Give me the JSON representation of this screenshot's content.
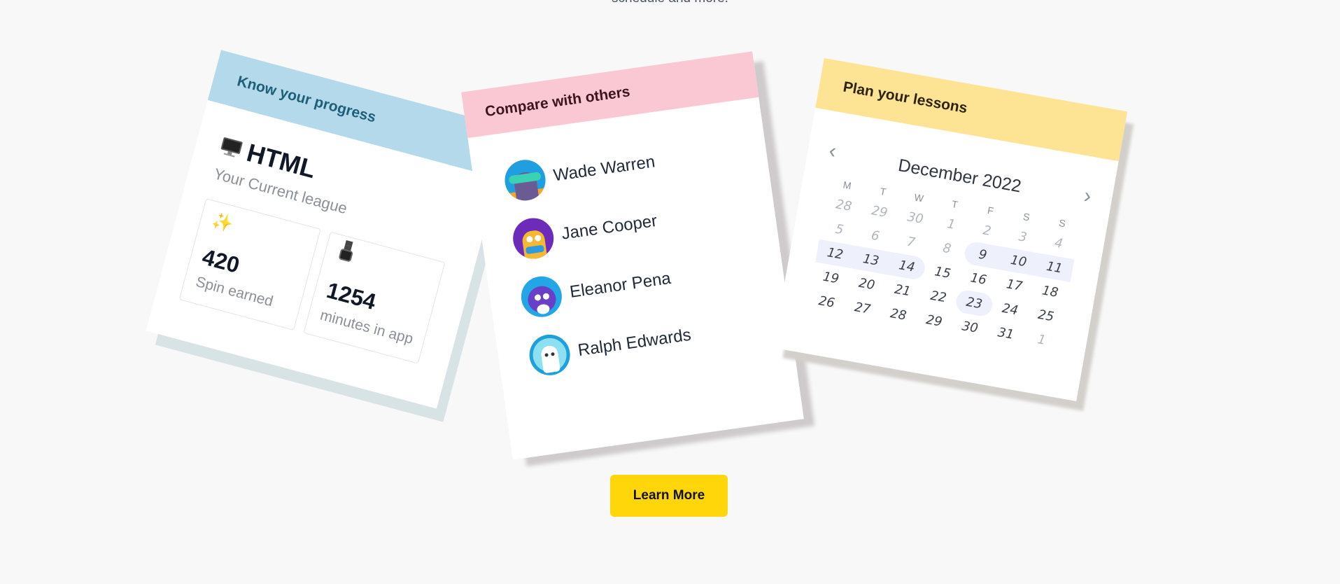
{
  "intro_text": "schedule and more.",
  "progress_card": {
    "header": "Know your progress",
    "title": "HTML",
    "subtitle": "Your Current league",
    "stats": [
      {
        "icon": "sparkles-icon",
        "value": "420",
        "label": "Spin earned"
      },
      {
        "icon": "watch-icon",
        "value": "1254",
        "label": "minutes in app"
      }
    ]
  },
  "compare_card": {
    "header": "Compare with others",
    "people": [
      {
        "name": "Wade Warren",
        "avatar": "avatar-goggles"
      },
      {
        "name": "Jane Cooper",
        "avatar": "avatar-lion"
      },
      {
        "name": "Eleanor Pena",
        "avatar": "avatar-bear"
      },
      {
        "name": "Ralph Edwards",
        "avatar": "avatar-astronaut-penguin"
      }
    ]
  },
  "calendar_card": {
    "header": "Plan your lessons",
    "month": "December 2022",
    "weekdays": [
      "M",
      "T",
      "W",
      "T",
      "F",
      "S",
      "S"
    ],
    "weeks": [
      [
        "28",
        "29",
        "30",
        "1",
        "2",
        "3",
        "4"
      ],
      [
        "5",
        "6",
        "7",
        "8",
        "9",
        "10",
        "11"
      ],
      [
        "12",
        "13",
        "14",
        "15",
        "16",
        "17",
        "18"
      ],
      [
        "19",
        "20",
        "21",
        "22",
        "23",
        "24",
        "25"
      ],
      [
        "26",
        "27",
        "28",
        "29",
        "30",
        "31",
        "1"
      ]
    ]
  },
  "cta": {
    "label": "Learn More"
  },
  "colors": {
    "progress_header": "#b4d9ea",
    "compare_header": "#fac8d2",
    "calendar_header": "#fde394",
    "button": "#ffd60a"
  }
}
